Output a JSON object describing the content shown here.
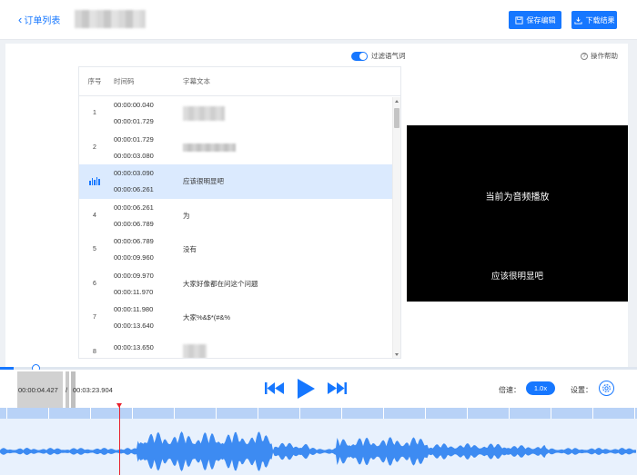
{
  "header": {
    "back_label": "订单列表",
    "save_label": "保存编辑",
    "download_label": "下载结果"
  },
  "toolbar": {
    "filter_label": "过滤语气词",
    "filter_on": true,
    "help_label": "操作帮助"
  },
  "table": {
    "columns": [
      "序号",
      "时间码",
      "字幕文本"
    ],
    "rows": [
      {
        "index": "1",
        "start": "00:00:00.040",
        "end": "00:00:01.729",
        "text": "",
        "redacted": true
      },
      {
        "index": "2",
        "start": "00:00:01.729",
        "end": "00:00:03.080",
        "text": "",
        "redacted": true
      },
      {
        "index": "",
        "start": "00:00:03.090",
        "end": "00:00:06.261",
        "text": "应该很明显吧",
        "active": true
      },
      {
        "index": "4",
        "start": "00:00:06.261",
        "end": "00:00:06.789",
        "text": "为"
      },
      {
        "index": "5",
        "start": "00:00:06.789",
        "end": "00:00:09.960",
        "text": "没有"
      },
      {
        "index": "6",
        "start": "00:00:09.970",
        "end": "00:00:11.970",
        "text": "大家好像都在问这个问题"
      },
      {
        "index": "7",
        "start": "00:00:11.980",
        "end": "00:00:13.640",
        "text": "大家%&$*(#&%"
      },
      {
        "index": "8",
        "start": "00:00:13.650",
        "end": "",
        "text": "",
        "redacted": true
      }
    ]
  },
  "preview": {
    "message": "当前为音频播放",
    "subtitle": "应该很明显吧"
  },
  "player": {
    "current_time": "00:00:04.427",
    "separator": "/",
    "total_time": "00:03:23.904",
    "progress_fraction": 0.022,
    "speed_label": "倍速：",
    "speed_value": "1.0x",
    "settings_label": "设置："
  },
  "colors": {
    "accent": "#1677ff",
    "active_row": "#dbeafe",
    "waveform": "#3d8bf2",
    "playhead": "#e8212e"
  }
}
